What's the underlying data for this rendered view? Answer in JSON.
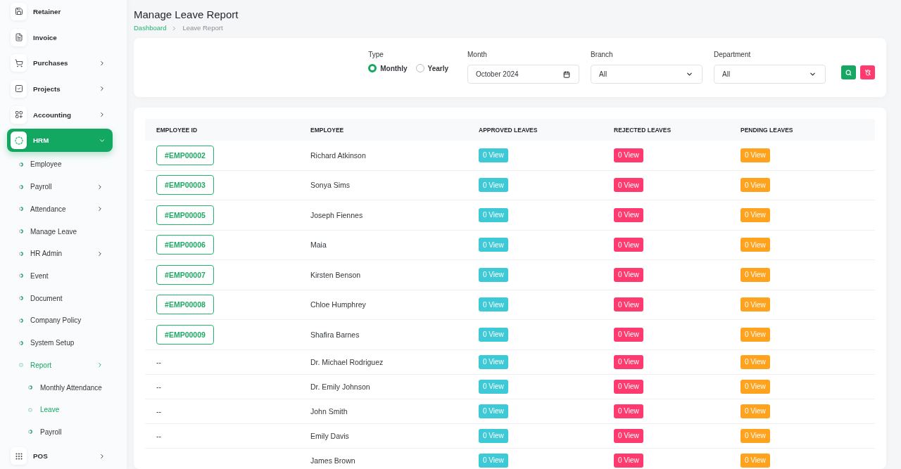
{
  "sidebar": {
    "items": [
      {
        "label": "Retainer",
        "submenu": false,
        "expanded": false,
        "selected": false
      },
      {
        "label": "Invoice",
        "submenu": false,
        "expanded": false,
        "selected": false
      },
      {
        "label": "Purchases",
        "submenu": true,
        "expanded": false,
        "selected": false
      },
      {
        "label": "Projects",
        "submenu": true,
        "expanded": false,
        "selected": false
      },
      {
        "label": "Accounting",
        "submenu": true,
        "expanded": false,
        "selected": false
      },
      {
        "label": "HRM",
        "submenu": true,
        "expanded": true,
        "selected": true,
        "children": [
          {
            "label": "Employee",
            "submenu": false,
            "selected": false
          },
          {
            "label": "Payroll",
            "submenu": true,
            "selected": false
          },
          {
            "label": "Attendance",
            "submenu": true,
            "selected": false
          },
          {
            "label": "Manage Leave",
            "submenu": false,
            "selected": false
          },
          {
            "label": "HR Admin",
            "submenu": true,
            "selected": false
          },
          {
            "label": "Event",
            "submenu": false,
            "selected": false
          },
          {
            "label": "Document",
            "submenu": false,
            "selected": false
          },
          {
            "label": "Company Policy",
            "submenu": false,
            "selected": false
          },
          {
            "label": "System Setup",
            "submenu": false,
            "selected": false
          },
          {
            "label": "Report",
            "submenu": true,
            "selected": true,
            "children": [
              {
                "label": "Monthly Attendance",
                "selected": false
              },
              {
                "label": "Leave",
                "selected": true
              },
              {
                "label": "Payroll",
                "selected": false
              }
            ]
          }
        ]
      },
      {
        "label": "POS",
        "submenu": true,
        "expanded": false,
        "selected": false
      }
    ]
  },
  "page": {
    "title": "Manage Leave Report",
    "breadcrumb": [
      {
        "label": "Dashboard",
        "selected": false
      },
      {
        "label": "Leave Report",
        "selected": true
      }
    ]
  },
  "filters": {
    "type": {
      "label": "Type",
      "options": [
        {
          "label": "Monthly",
          "selected": true
        },
        {
          "label": "Yearly",
          "selected": false
        }
      ]
    },
    "month": {
      "label": "Month",
      "value": "October 2024"
    },
    "branch": {
      "label": "Branch",
      "value": "All"
    },
    "department": {
      "label": "Department",
      "value": "All"
    }
  },
  "table": {
    "columns": [
      "EMPLOYEE ID",
      "EMPLOYEE",
      "APPROVED LEAVES",
      "REJECTED LEAVES",
      "PENDING LEAVES"
    ],
    "rows": [
      {
        "kind": "linked",
        "employee_id": "#EMP00002",
        "employee": "Richard Atkinson",
        "approved": "0 View",
        "rejected": "0 View",
        "pending": "0 View"
      },
      {
        "kind": "linked",
        "employee_id": "#EMP00003",
        "employee": "Sonya Sims",
        "approved": "0 View",
        "rejected": "0 View",
        "pending": "0 View"
      },
      {
        "kind": "linked",
        "employee_id": "#EMP00005",
        "employee": "Joseph Fiennes",
        "approved": "0 View",
        "rejected": "0 View",
        "pending": "0 View"
      },
      {
        "kind": "linked",
        "employee_id": "#EMP00006",
        "employee": "Maia",
        "approved": "0 View",
        "rejected": "0 View",
        "pending": "0 View"
      },
      {
        "kind": "linked",
        "employee_id": "#EMP00007",
        "employee": "Kirsten Benson",
        "approved": "0 View",
        "rejected": "0 View",
        "pending": "0 View"
      },
      {
        "kind": "linked",
        "employee_id": "#EMP00008",
        "employee": "Chloe Humphrey",
        "approved": "0 View",
        "rejected": "0 View",
        "pending": "0 View"
      },
      {
        "kind": "linked",
        "employee_id": "#EMP00009",
        "employee": "Shafira Barnes",
        "approved": "0 View",
        "rejected": "0 View",
        "pending": "0 View"
      },
      {
        "kind": "plain",
        "employee_id": "--",
        "employee": "Dr. Michael Rodriguez",
        "approved": "0 View",
        "rejected": "0 View",
        "pending": "0 View"
      },
      {
        "kind": "plain",
        "employee_id": "--",
        "employee": "Dr. Emily Johnson",
        "approved": "0 View",
        "rejected": "0 View",
        "pending": "0 View"
      },
      {
        "kind": "plain",
        "employee_id": "--",
        "employee": "John Smith",
        "approved": "0 View",
        "rejected": "0 View",
        "pending": "0 View"
      },
      {
        "kind": "plain",
        "employee_id": "--",
        "employee": "Emily Davis",
        "approved": "0 View",
        "rejected": "0 View",
        "pending": "0 View"
      },
      {
        "kind": "plain",
        "employee": "James Brown",
        "approved": "0 View",
        "rejected": "0 View",
        "pending": "0 View"
      }
    ]
  }
}
